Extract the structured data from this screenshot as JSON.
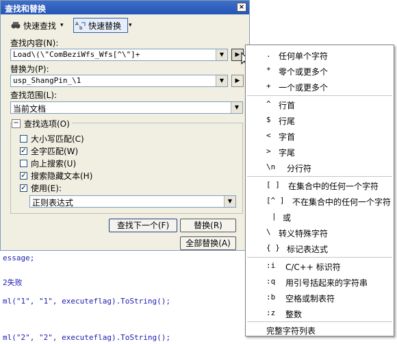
{
  "dialog": {
    "title": "查找和替换",
    "close_symbol": "×",
    "toolbar": {
      "quick_find": "快速查找",
      "quick_replace": "快速替换",
      "dropdown_symbol": "▾"
    },
    "find_label": "查找内容(N):",
    "find_value": "Load\\(\\\"ComBeziWfs_Wfs[^\\\"]+",
    "replace_label": "替换为(P):",
    "replace_value": "usp_ShangPin_\\1",
    "scope_label": "查找范围(L):",
    "scope_value": "当前文档",
    "options_group_label": "查找选项(O)",
    "options_toggle": "−",
    "options": [
      {
        "label": "大小写匹配(C)",
        "checked": false
      },
      {
        "label": "全字匹配(W)",
        "checked": true
      },
      {
        "label": "向上搜索(U)",
        "checked": false
      },
      {
        "label": "搜索隐藏文本(H)",
        "checked": true
      },
      {
        "label": "使用(E):",
        "checked": true
      }
    ],
    "check_mark": "✓",
    "use_value": "正则表达式",
    "find_next_button": "查找下一个(F)",
    "replace_button": "替换(R)",
    "replace_all_button": "全部替换(A)"
  },
  "editor": {
    "lines": [
      {
        "text": "essage;"
      },
      {
        "text": "2失败"
      },
      {
        "text": "ml(\"1\", \"1\", executeflag).ToString();"
      },
      {
        "text": "ml(\"2\", \"2\", executeflag).ToString();"
      }
    ]
  },
  "menu": {
    "items": [
      {
        "symbol": ".",
        "label": "任何单个字符"
      },
      {
        "symbol": "*",
        "label": "零个或更多个"
      },
      {
        "symbol": "+",
        "label": "一个或更多个"
      },
      {
        "symbol": "^",
        "label": "行首"
      },
      {
        "symbol": "$",
        "label": "行尾"
      },
      {
        "symbol": "<",
        "label": "字首"
      },
      {
        "symbol": ">",
        "label": "字尾"
      },
      {
        "symbol": "\\n",
        "label": "分行符"
      },
      {
        "symbol": "[ ]",
        "label": "在集合中的任何一个字符"
      },
      {
        "symbol": "[^ ]",
        "label": "不在集合中的任何一个字符"
      },
      {
        "symbol": "|",
        "label": "或"
      },
      {
        "symbol": "\\",
        "label": "转义特殊字符"
      },
      {
        "symbol": "{ }",
        "label": "标记表达式"
      },
      {
        "symbol": ":i",
        "label": "C/C++ 标识符"
      },
      {
        "symbol": ":q",
        "label": "用引号括起来的字符串"
      },
      {
        "symbol": ":b",
        "label": "空格或制表符"
      },
      {
        "symbol": ":z",
        "label": "整数"
      }
    ],
    "footer": "完整字符列表"
  },
  "colors": {
    "titlebar": "#2455b7",
    "dialog_bg": "#f1efe2",
    "code_blue": "#1a1ab0"
  }
}
